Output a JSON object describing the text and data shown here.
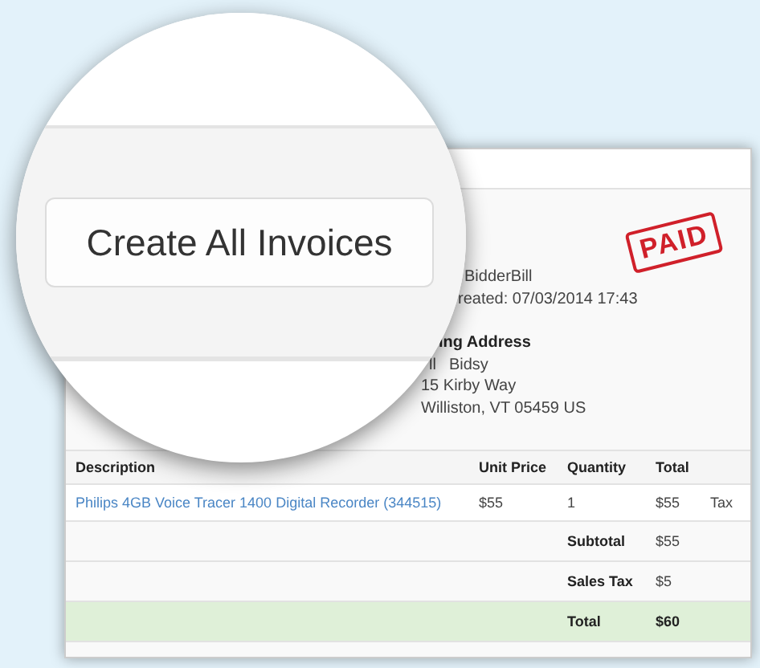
{
  "magnifier": {
    "button": "Create All Invoices"
  },
  "invoice": {
    "stamp": "PAID",
    "customer_lines": [
      "BidderBill",
      "reated: 07/03/2014 17:43"
    ],
    "billing": {
      "heading": "ing Address",
      "name_parts": [
        "ll",
        "Bidsy"
      ],
      "lines": [
        "15 Kirby Way",
        "Williston, VT 05459 US"
      ]
    },
    "table": {
      "columns": [
        "Description",
        "Unit Price",
        "Quantity",
        "Total"
      ],
      "items": [
        {
          "description": "Philips 4GB Voice Tracer 1400 Digital Recorder (344515)",
          "unit_price": "$55",
          "quantity": "1",
          "total": "$55",
          "tax": "Tax"
        }
      ],
      "summary": [
        {
          "label": "Subtotal",
          "value": "$55",
          "highlight": false
        },
        {
          "label": "Sales Tax",
          "value": "$5",
          "highlight": false
        },
        {
          "label": "Total",
          "value": "$60",
          "highlight": true
        }
      ]
    }
  }
}
